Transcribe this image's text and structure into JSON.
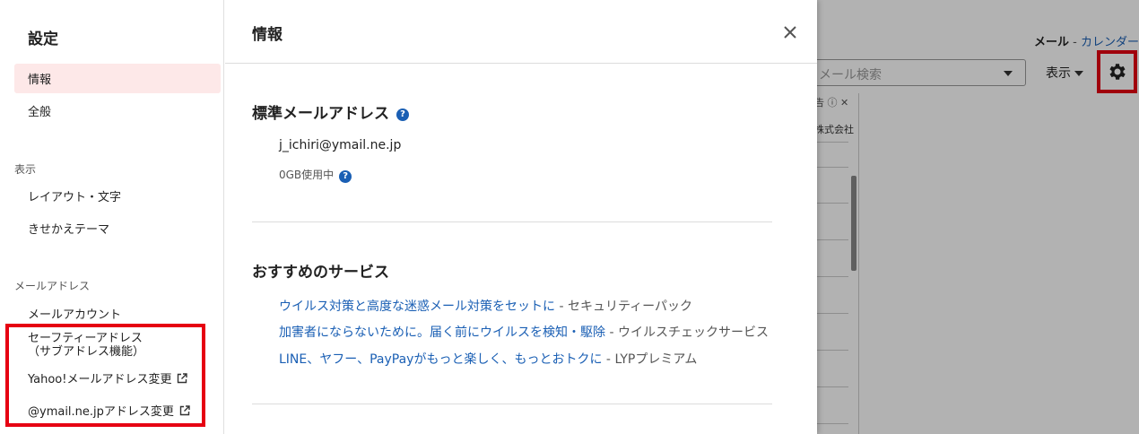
{
  "background": {
    "top_nav": {
      "mail": "メール",
      "separator": "-",
      "calendar": "カレンダー"
    },
    "search": {
      "placeholder": "メール検索"
    },
    "view_label": "表示",
    "ad_header": "告",
    "ad_company": "株式会社"
  },
  "settings": {
    "title": "設定",
    "nav": [
      {
        "label": "情報",
        "active": true
      },
      {
        "label": "全般"
      }
    ],
    "display_section": {
      "heading": "表示",
      "items": [
        {
          "label": "レイアウト・文字"
        },
        {
          "label": "きせかえテーマ"
        }
      ]
    },
    "address_section": {
      "heading": "メールアドレス",
      "items": [
        {
          "label": "メールアカウント"
        },
        {
          "line1": "セーフティーアドレス",
          "line2": "（サブアドレス機能）"
        },
        {
          "label": "Yahoo!メールアドレス変更"
        },
        {
          "label": "@ymail.ne.jpアドレス変更"
        }
      ]
    }
  },
  "info": {
    "title": "情報",
    "standard_address": {
      "heading": "標準メールアドレス",
      "email": "j_ichiri@ymail.ne.jp",
      "usage": "0GB使用中"
    },
    "recommended": {
      "heading": "おすすめのサービス",
      "items": [
        {
          "link": "ウイルス対策と高度な迷惑メール対策をセットに",
          "dash": "-",
          "service": "セキュリティーパック"
        },
        {
          "link": "加害者にならないために。届く前にウイルスを検知・駆除",
          "dash": "-",
          "service": "ウイルスチェックサービス"
        },
        {
          "link": "LINE、ヤフー、PayPayがもっと楽しく、もっとおトクに",
          "dash": "-",
          "service": "LYPプレミアム"
        }
      ]
    }
  },
  "colors": {
    "link": "#1a5fb4",
    "highlight": "#e60012",
    "active_bg": "#fde8e8"
  },
  "icons": [
    "gear-icon",
    "close-icon",
    "help-icon",
    "external-link-icon",
    "info-icon",
    "caret-down-icon"
  ]
}
